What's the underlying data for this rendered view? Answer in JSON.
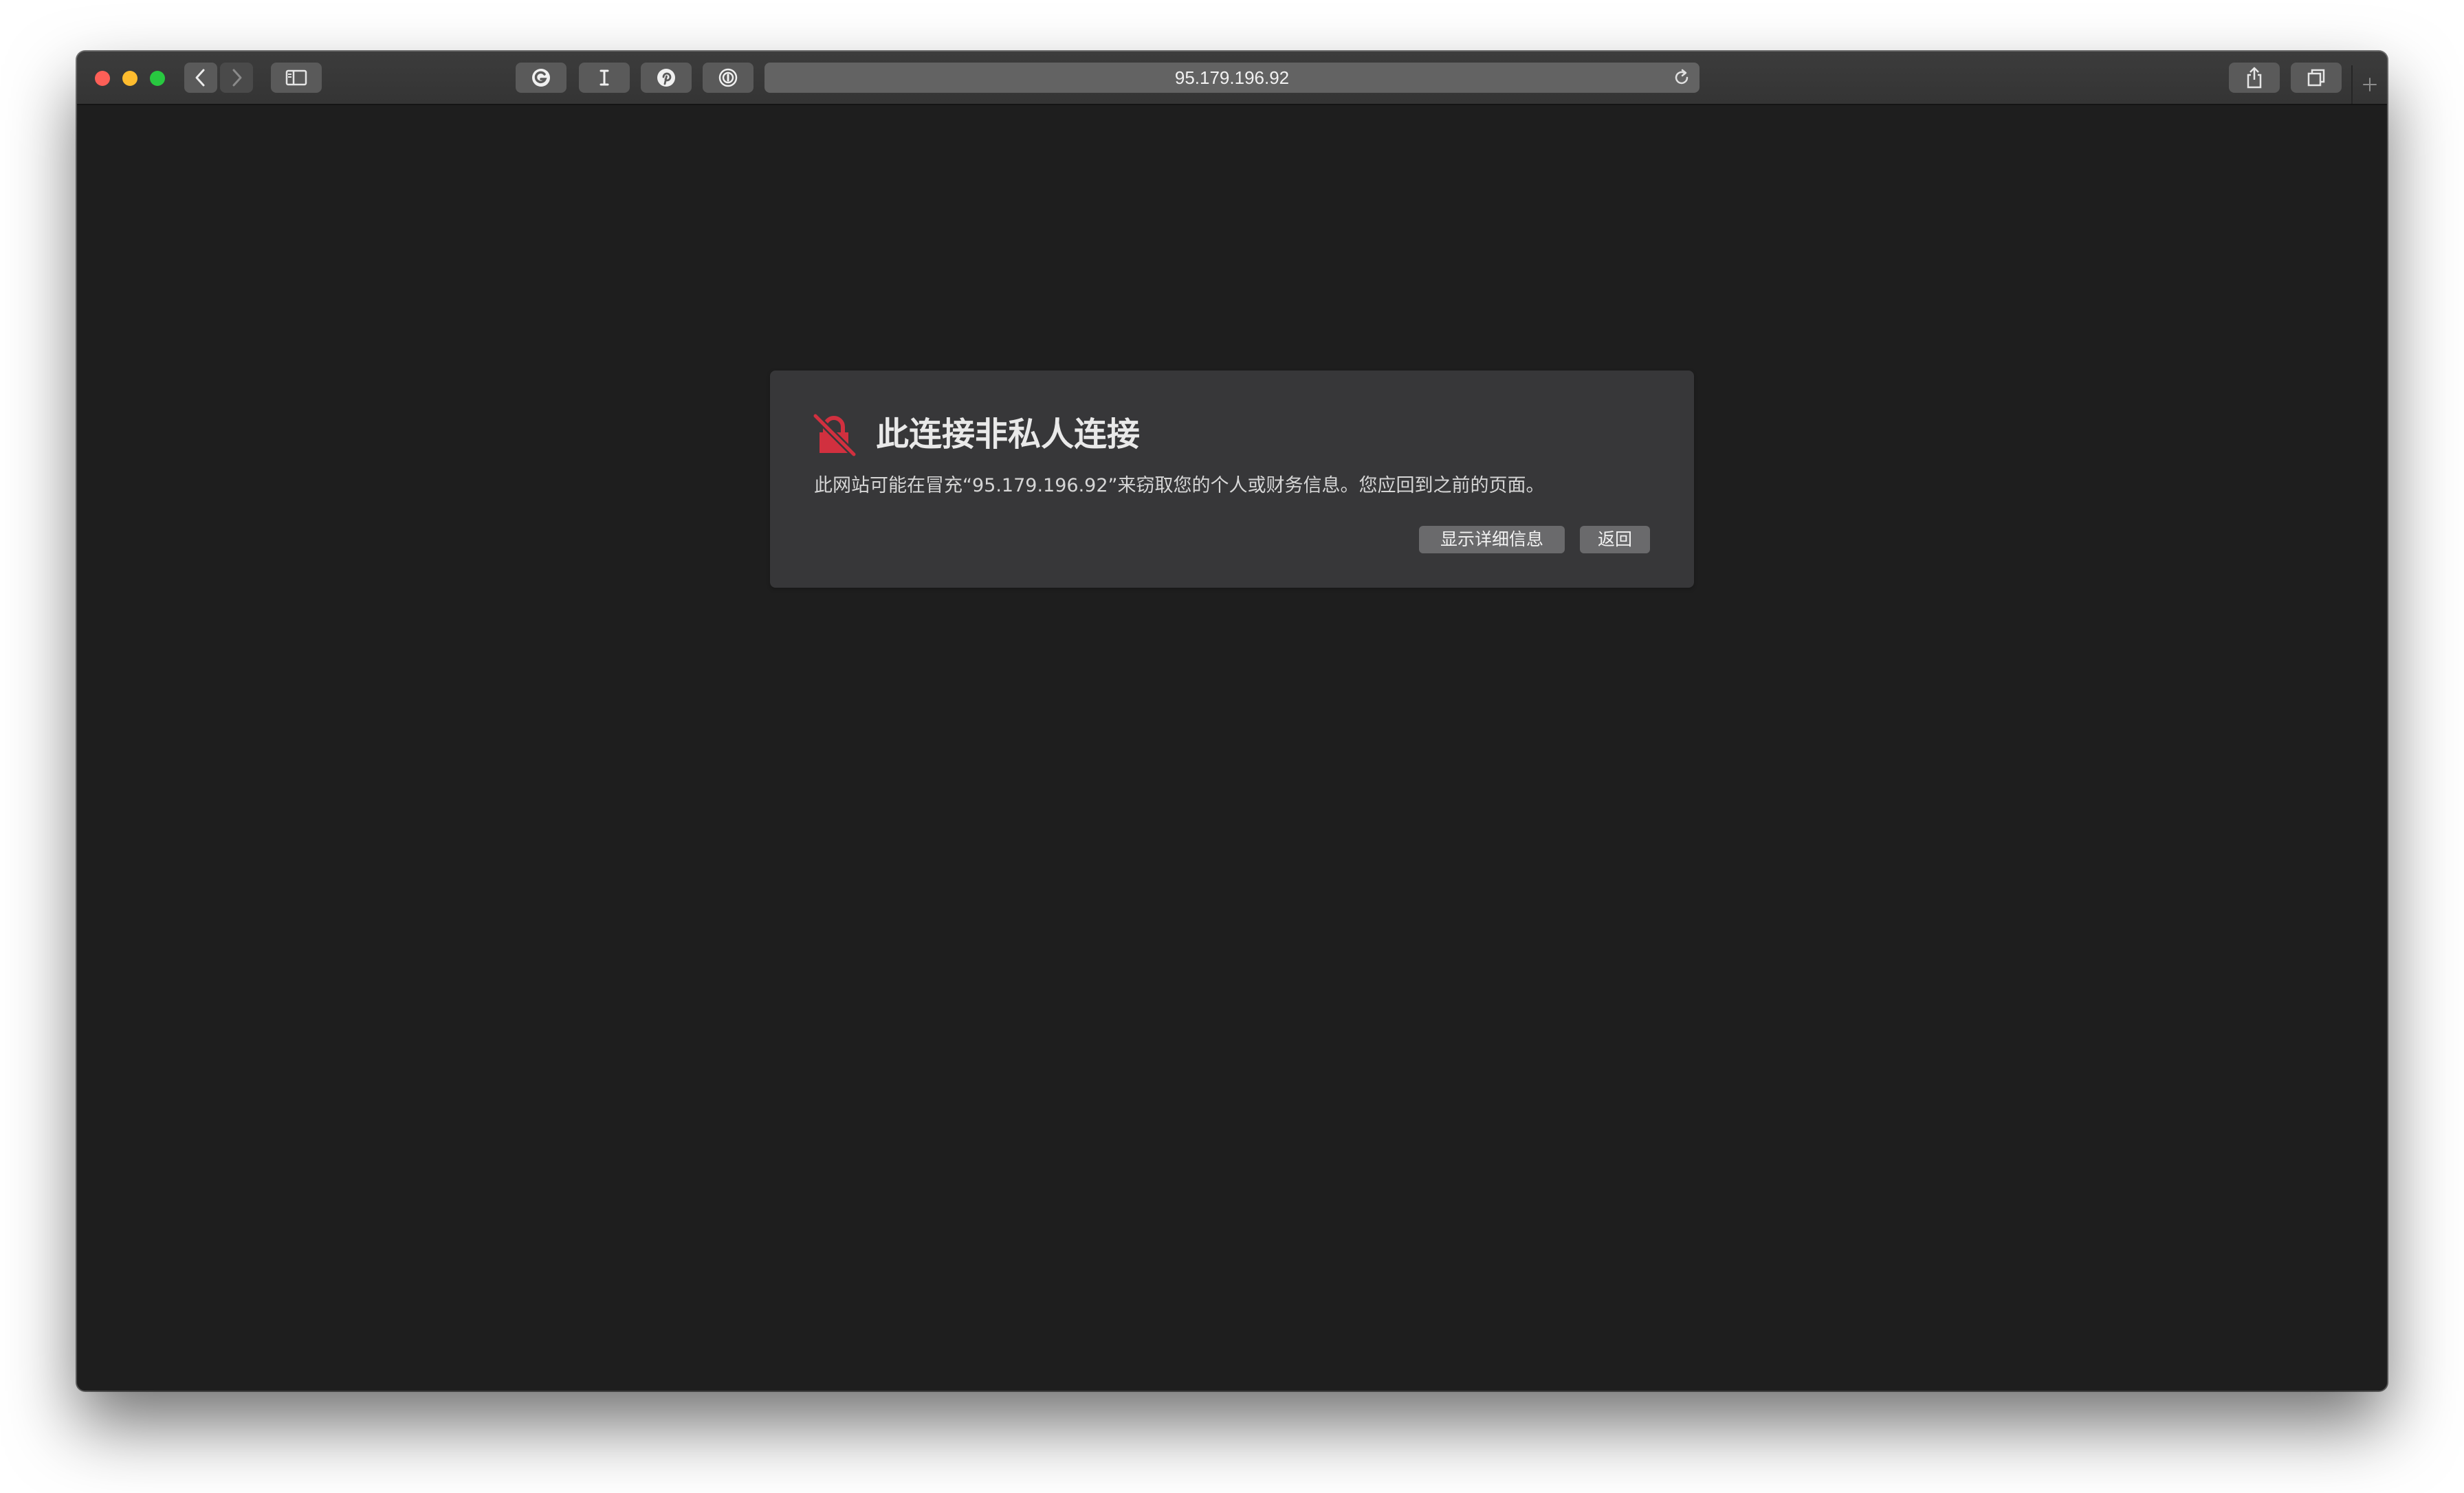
{
  "browser": {
    "address": "95.179.196.92",
    "toolbar_icons": {
      "back": "chevron-left-icon",
      "forward": "chevron-right-icon",
      "sidebar": "sidebar-icon",
      "extension_1": "grammarly-icon",
      "extension_2": "text-cursor-icon",
      "extension_3": "pinterest-icon",
      "extension_4": "password-manager-icon",
      "reload": "reload-icon",
      "share": "share-icon",
      "tabs": "tab-overview-icon",
      "new_tab": "plus-icon"
    }
  },
  "dialog": {
    "title": "此连接非私人连接",
    "message": "此网站可能在冒充“95.179.196.92”来窃取您的个人或财务信息。您应回到之前的页面。",
    "details_button": "显示详细信息",
    "back_button": "返回",
    "icon": "broken-lock-icon"
  },
  "colors": {
    "page_background": "#1e1e1e",
    "dialog_background": "#373739",
    "warning_red": "#d1303f",
    "traffic_close": "#fd5f57",
    "traffic_minimize": "#febc2e",
    "traffic_maximize": "#28c840"
  }
}
